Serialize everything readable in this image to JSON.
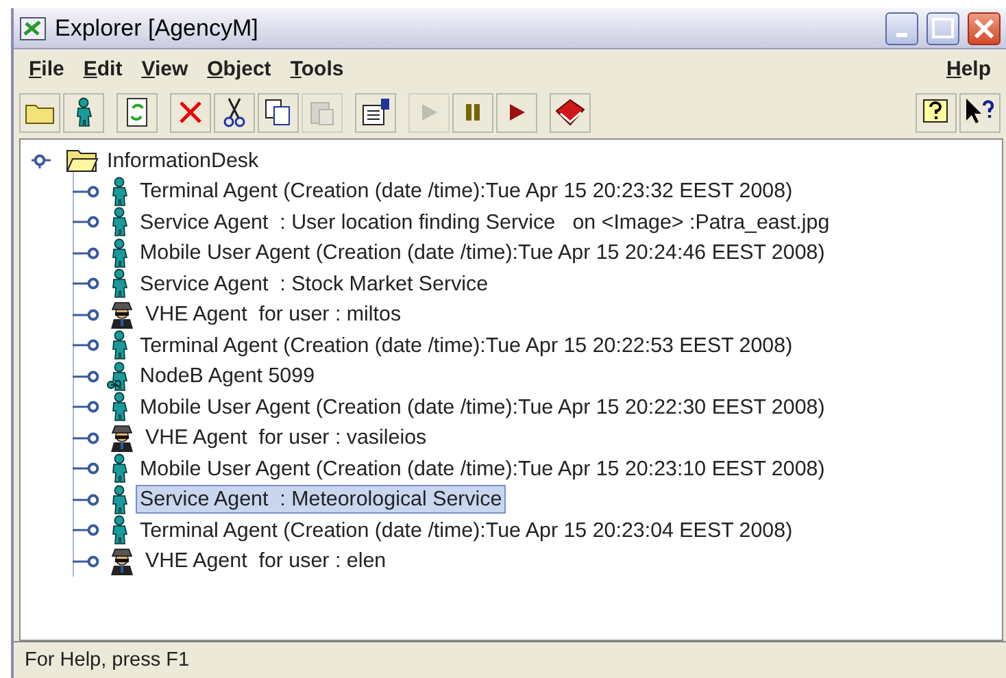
{
  "window": {
    "title": "Explorer [AgencyM]"
  },
  "menus": {
    "left": [
      "File",
      "Edit",
      "View",
      "Object",
      "Tools"
    ],
    "right": [
      "Help"
    ]
  },
  "toolbar": {
    "left": [
      [
        {
          "kind": "open",
          "disabled": false
        },
        {
          "kind": "agent",
          "disabled": false
        }
      ],
      [
        {
          "kind": "refresh",
          "disabled": false
        }
      ],
      [
        {
          "kind": "delete",
          "disabled": false
        },
        {
          "kind": "cut",
          "disabled": false
        },
        {
          "kind": "copy",
          "disabled": false
        },
        {
          "kind": "paste",
          "disabled": true
        }
      ],
      [
        {
          "kind": "properties",
          "disabled": false
        }
      ],
      [
        {
          "kind": "play",
          "disabled": true
        },
        {
          "kind": "pause",
          "disabled": false
        },
        {
          "kind": "stop",
          "disabled": false
        }
      ],
      [
        {
          "kind": "book",
          "disabled": false
        }
      ]
    ],
    "right": [
      {
        "kind": "help",
        "disabled": false
      },
      {
        "kind": "whatsthis",
        "disabled": false
      }
    ]
  },
  "tree": {
    "label": "InformationDesk",
    "expanded": true,
    "children": [
      {
        "kind": "agent",
        "label": "Terminal Agent (Creation (date /time):Tue Apr 15 20:23:32 EEST 2008)",
        "selected": false
      },
      {
        "kind": "agent",
        "label": "Service Agent  : User location finding Service   on <Image> :Patra_east.jpg",
        "selected": false
      },
      {
        "kind": "agent",
        "label": "Mobile User Agent (Creation (date /time):Tue Apr 15 20:24:46 EEST 2008)",
        "selected": false
      },
      {
        "kind": "agent",
        "label": "Service Agent  : Stock Market Service",
        "selected": false
      },
      {
        "kind": "vhe",
        "label": "VHE Agent  for user : miltos",
        "selected": false
      },
      {
        "kind": "agent",
        "label": "Terminal Agent (Creation (date /time):Tue Apr 15 20:22:53 EEST 2008)",
        "selected": false
      },
      {
        "kind": "nodeb",
        "label": "NodeB Agent 5099",
        "selected": false
      },
      {
        "kind": "agent",
        "label": "Mobile User Agent (Creation (date /time):Tue Apr 15 20:22:30 EEST 2008)",
        "selected": false
      },
      {
        "kind": "vhe",
        "label": "VHE Agent  for user : vasileios",
        "selected": false
      },
      {
        "kind": "agent",
        "label": "Mobile User Agent (Creation (date /time):Tue Apr 15 20:23:10 EEST 2008)",
        "selected": false
      },
      {
        "kind": "agent",
        "label": "Service Agent  : Meteorological Service",
        "selected": true
      },
      {
        "kind": "agent",
        "label": "Terminal Agent (Creation (date /time):Tue Apr 15 20:23:04 EEST 2008)",
        "selected": false
      },
      {
        "kind": "vhe",
        "label": "VHE Agent  for user : elen",
        "selected": false
      }
    ]
  },
  "status_bar": "For Help, press F1"
}
